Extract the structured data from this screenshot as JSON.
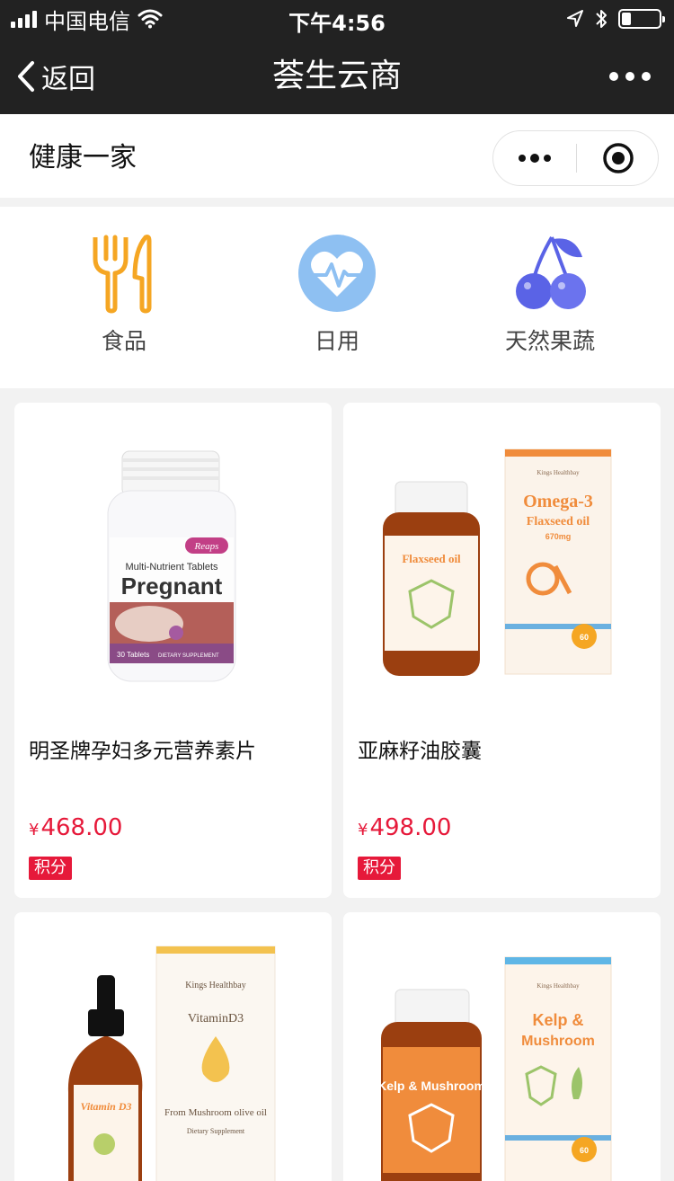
{
  "status_bar": {
    "carrier": "中国电信",
    "time": "下午4:56",
    "battery_level": 0.25
  },
  "nav": {
    "back_label": "返回",
    "title": "荟生云商"
  },
  "sub_header": {
    "title": "健康一家"
  },
  "categories": [
    {
      "label": "食品",
      "icon": "fork-knife-icon",
      "color": "#f5a623"
    },
    {
      "label": "日用",
      "icon": "heartbeat-icon",
      "color": "#6aa8ec"
    },
    {
      "label": "天然果蔬",
      "icon": "cherry-icon",
      "color": "#5a63e6"
    }
  ],
  "products": [
    {
      "name": "明圣牌孕妇多元营养素片",
      "currency": "¥",
      "price": "468.00",
      "badge": "积分",
      "image_text": {
        "brand": "Reaps",
        "line1": "Multi-Nutrient Tablets",
        "line2": "Pregnant",
        "count": "30 Tablets",
        "sub": "DIETARY SUPPLEMENT"
      }
    },
    {
      "name": "亚麻籽油胶囊",
      "currency": "¥",
      "price": "498.00",
      "badge": "积分",
      "image_text": {
        "brand": "Kings Healthbay",
        "label": "Flaxseed oil",
        "box_title": "Omega-3",
        "box_sub": "Flaxseed oil",
        "dose": "670mg",
        "count": "60"
      }
    },
    {
      "name": "",
      "currency": "",
      "price": "",
      "badge": "",
      "image_text": {
        "brand": "Kings Healthbay",
        "label": "Vitamin D3",
        "box_title": "VitaminD3",
        "box_sub": "From Mushroom olive oil",
        "note": "Dietary Supplement"
      }
    },
    {
      "name": "",
      "currency": "",
      "price": "",
      "badge": "",
      "image_text": {
        "brand": "Kings Healthbay",
        "label": "Kelp & Mushroom",
        "box_title": "Kelp &",
        "box_sub": "Mushroom",
        "count": "60"
      }
    }
  ],
  "colors": {
    "bar_bg": "#222222",
    "price_red": "#e6193a",
    "page_bg": "#f2f2f2"
  }
}
